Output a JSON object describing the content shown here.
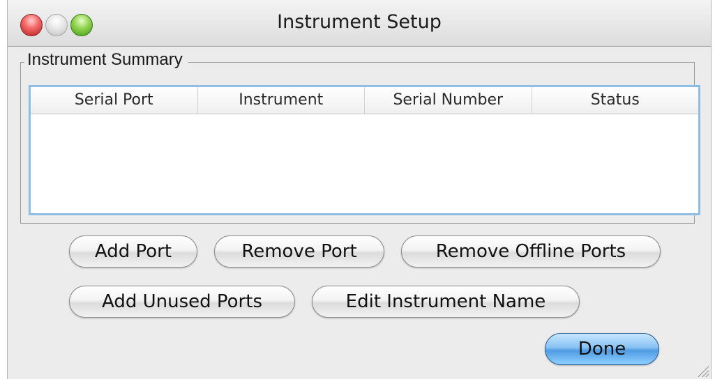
{
  "window": {
    "title": "Instrument Setup"
  },
  "summary": {
    "legend": "Instrument Summary",
    "columns": [
      "Serial Port",
      "Instrument",
      "Serial Number",
      "Status"
    ],
    "rows": []
  },
  "buttons": {
    "add_port": "Add Port",
    "remove_port": "Remove Port",
    "remove_offline_ports": "Remove Offline Ports",
    "add_unused_ports": "Add Unused Ports",
    "edit_instrument_name": "Edit Instrument Name",
    "done": "Done"
  },
  "colors": {
    "default_button": "#6aaee9",
    "table_focus_border": "#8ebde6"
  }
}
